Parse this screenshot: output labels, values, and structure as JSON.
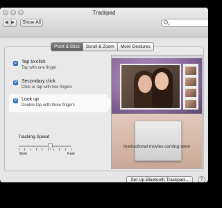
{
  "window": {
    "title": "Trackpad"
  },
  "toolbar": {
    "back_glyph": "◀",
    "forward_glyph": "▶",
    "show_all_label": "Show All",
    "search_placeholder": ""
  },
  "tabs": [
    {
      "label": "Point & Click",
      "active": true
    },
    {
      "label": "Scroll & Zoom",
      "active": false
    },
    {
      "label": "More Gestures",
      "active": false
    }
  ],
  "options": [
    {
      "title": "Tap to click",
      "subtitle": "Tap with one finger",
      "checked": true,
      "selected": false
    },
    {
      "title": "Secondary click",
      "subtitle": "Click or tap with two fingers",
      "checked": true,
      "selected": false
    },
    {
      "title": "Look up",
      "subtitle": "Double-tap with three fingers",
      "checked": true,
      "selected": true
    }
  ],
  "check_glyph": "✓",
  "tracking": {
    "label": "Tracking Speed",
    "min_label": "Slow",
    "max_label": "Fast",
    "value_fraction": 0.6
  },
  "preview": {
    "caption": "Instructional movies coming soon"
  },
  "footer": {
    "bluetooth_button": "Set Up Bluetooth Trackpad...",
    "help_label": "?"
  }
}
